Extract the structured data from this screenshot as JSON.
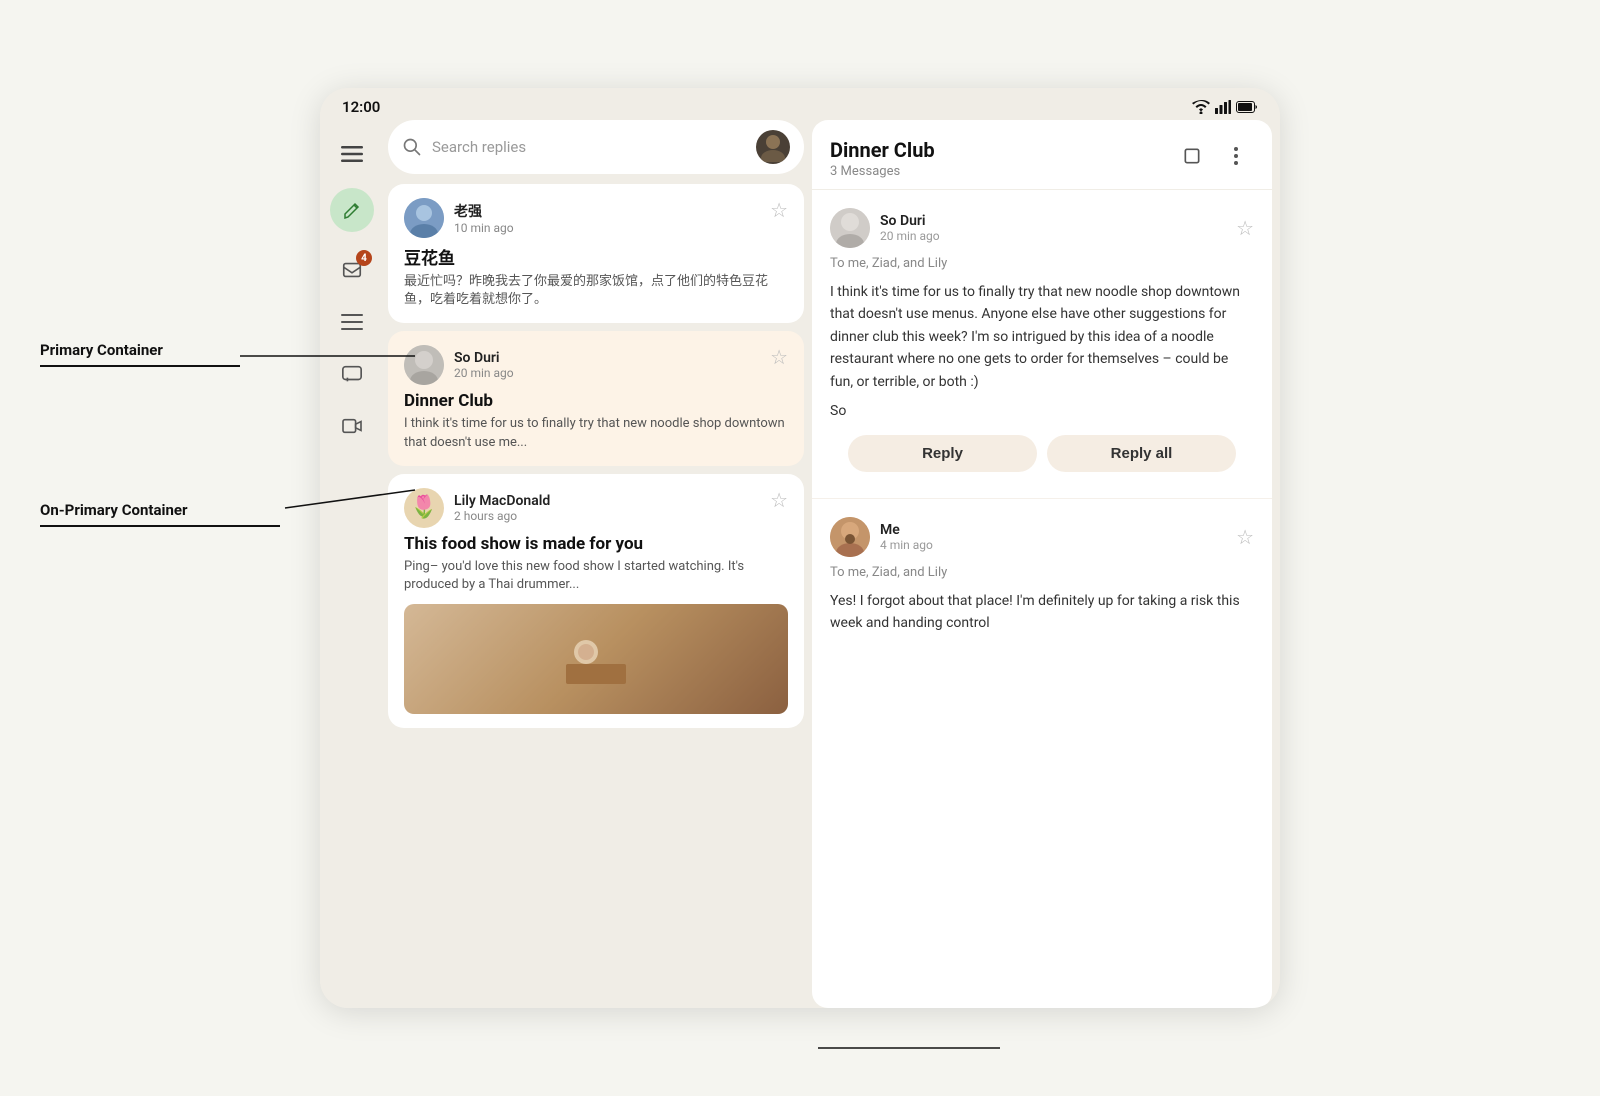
{
  "statusBar": {
    "time": "12:00",
    "icons": [
      "wifi",
      "signal",
      "battery"
    ]
  },
  "sidebar": {
    "icons": [
      {
        "name": "menu-icon",
        "symbol": "☰",
        "badge": null,
        "active": false
      },
      {
        "name": "compose-icon",
        "symbol": "✏",
        "badge": null,
        "active": false,
        "fab": true
      },
      {
        "name": "inbox-icon",
        "symbol": "🖼",
        "badge": "4",
        "active": false
      },
      {
        "name": "list-icon",
        "symbol": "≡",
        "badge": null,
        "active": false
      },
      {
        "name": "chat-icon",
        "symbol": "□",
        "badge": null,
        "active": false
      },
      {
        "name": "video-icon",
        "symbol": "▷",
        "badge": null,
        "active": false
      }
    ]
  },
  "search": {
    "placeholder": "Search replies"
  },
  "emailList": {
    "emails": [
      {
        "id": "email-1",
        "sender": "老强",
        "time": "10 min ago",
        "subject": "豆花鱼",
        "preview": "最近忙吗？昨晚我去了你最爱的那家饭馆，点了他们的特色豆花鱼，吃着吃着就想你了。",
        "avatarType": "laozi",
        "selected": false,
        "starred": false
      },
      {
        "id": "email-2",
        "sender": "So Duri",
        "time": "20 min ago",
        "subject": "Dinner Club",
        "preview": "I think it's time for us to finally try that new noodle shop downtown that doesn't use me...",
        "avatarType": "soduri",
        "selected": true,
        "starred": false
      },
      {
        "id": "email-3",
        "sender": "Lily MacDonald",
        "time": "2 hours ago",
        "subject": "This food show is made for you",
        "preview": "Ping– you'd love this new food show I started watching. It's produced by a Thai drummer...",
        "avatarType": "lily",
        "selected": false,
        "starred": false
      }
    ]
  },
  "detailPanel": {
    "title": "Dinner Club",
    "subtitle": "3 Messages",
    "messages": [
      {
        "id": "msg-1",
        "sender": "So Duri",
        "time": "20 min ago",
        "avatarType": "soduri",
        "recipients": "To me, Ziad, and Lily",
        "body": "I think it's time for us to finally try that new noodle shop downtown that doesn't use menus. Anyone else have other suggestions for dinner club this week? I'm so intrigued by this idea of a noodle restaurant where no one gets to order for themselves – could be fun, or terrible, or both :)",
        "signature": "So",
        "starred": false,
        "hasReplyButtons": true
      },
      {
        "id": "msg-2",
        "sender": "Me",
        "time": "4 min ago",
        "avatarType": "me",
        "recipients": "To me, Ziad, and Lily",
        "body": "Yes! I forgot about that place! I'm definitely up for taking a risk this week and handing control",
        "signature": "",
        "starred": false,
        "hasReplyButtons": false
      }
    ],
    "replyButtons": {
      "reply": "Reply",
      "replyAll": "Reply all"
    }
  },
  "annotations": {
    "primaryContainer": "Primary Container",
    "onPrimaryContainer": "On-Primary Container"
  }
}
